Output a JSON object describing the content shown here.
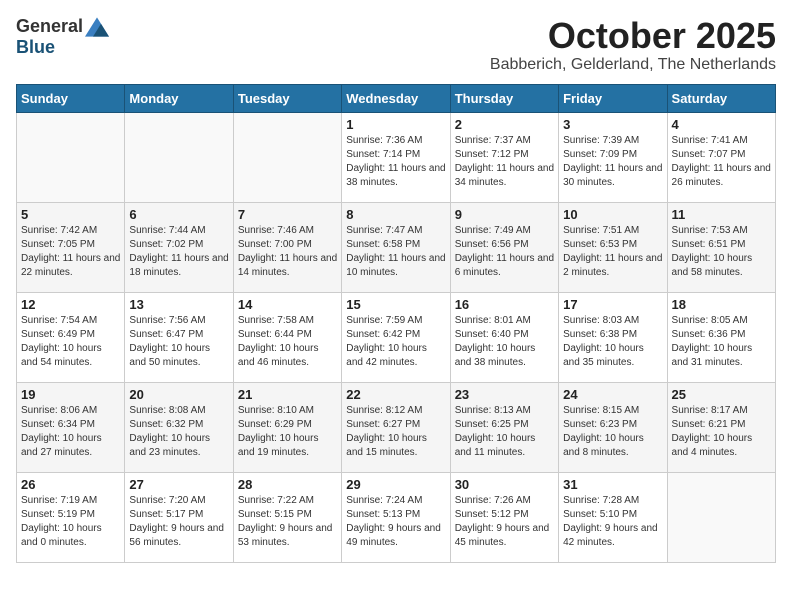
{
  "header": {
    "logo_general": "General",
    "logo_blue": "Blue",
    "month_title": "October 2025",
    "location": "Babberich, Gelderland, The Netherlands"
  },
  "weekdays": [
    "Sunday",
    "Monday",
    "Tuesday",
    "Wednesday",
    "Thursday",
    "Friday",
    "Saturday"
  ],
  "weeks": [
    [
      {
        "day": "",
        "sunrise": "",
        "sunset": "",
        "daylight": ""
      },
      {
        "day": "",
        "sunrise": "",
        "sunset": "",
        "daylight": ""
      },
      {
        "day": "",
        "sunrise": "",
        "sunset": "",
        "daylight": ""
      },
      {
        "day": "1",
        "sunrise": "Sunrise: 7:36 AM",
        "sunset": "Sunset: 7:14 PM",
        "daylight": "Daylight: 11 hours and 38 minutes."
      },
      {
        "day": "2",
        "sunrise": "Sunrise: 7:37 AM",
        "sunset": "Sunset: 7:12 PM",
        "daylight": "Daylight: 11 hours and 34 minutes."
      },
      {
        "day": "3",
        "sunrise": "Sunrise: 7:39 AM",
        "sunset": "Sunset: 7:09 PM",
        "daylight": "Daylight: 11 hours and 30 minutes."
      },
      {
        "day": "4",
        "sunrise": "Sunrise: 7:41 AM",
        "sunset": "Sunset: 7:07 PM",
        "daylight": "Daylight: 11 hours and 26 minutes."
      }
    ],
    [
      {
        "day": "5",
        "sunrise": "Sunrise: 7:42 AM",
        "sunset": "Sunset: 7:05 PM",
        "daylight": "Daylight: 11 hours and 22 minutes."
      },
      {
        "day": "6",
        "sunrise": "Sunrise: 7:44 AM",
        "sunset": "Sunset: 7:02 PM",
        "daylight": "Daylight: 11 hours and 18 minutes."
      },
      {
        "day": "7",
        "sunrise": "Sunrise: 7:46 AM",
        "sunset": "Sunset: 7:00 PM",
        "daylight": "Daylight: 11 hours and 14 minutes."
      },
      {
        "day": "8",
        "sunrise": "Sunrise: 7:47 AM",
        "sunset": "Sunset: 6:58 PM",
        "daylight": "Daylight: 11 hours and 10 minutes."
      },
      {
        "day": "9",
        "sunrise": "Sunrise: 7:49 AM",
        "sunset": "Sunset: 6:56 PM",
        "daylight": "Daylight: 11 hours and 6 minutes."
      },
      {
        "day": "10",
        "sunrise": "Sunrise: 7:51 AM",
        "sunset": "Sunset: 6:53 PM",
        "daylight": "Daylight: 11 hours and 2 minutes."
      },
      {
        "day": "11",
        "sunrise": "Sunrise: 7:53 AM",
        "sunset": "Sunset: 6:51 PM",
        "daylight": "Daylight: 10 hours and 58 minutes."
      }
    ],
    [
      {
        "day": "12",
        "sunrise": "Sunrise: 7:54 AM",
        "sunset": "Sunset: 6:49 PM",
        "daylight": "Daylight: 10 hours and 54 minutes."
      },
      {
        "day": "13",
        "sunrise": "Sunrise: 7:56 AM",
        "sunset": "Sunset: 6:47 PM",
        "daylight": "Daylight: 10 hours and 50 minutes."
      },
      {
        "day": "14",
        "sunrise": "Sunrise: 7:58 AM",
        "sunset": "Sunset: 6:44 PM",
        "daylight": "Daylight: 10 hours and 46 minutes."
      },
      {
        "day": "15",
        "sunrise": "Sunrise: 7:59 AM",
        "sunset": "Sunset: 6:42 PM",
        "daylight": "Daylight: 10 hours and 42 minutes."
      },
      {
        "day": "16",
        "sunrise": "Sunrise: 8:01 AM",
        "sunset": "Sunset: 6:40 PM",
        "daylight": "Daylight: 10 hours and 38 minutes."
      },
      {
        "day": "17",
        "sunrise": "Sunrise: 8:03 AM",
        "sunset": "Sunset: 6:38 PM",
        "daylight": "Daylight: 10 hours and 35 minutes."
      },
      {
        "day": "18",
        "sunrise": "Sunrise: 8:05 AM",
        "sunset": "Sunset: 6:36 PM",
        "daylight": "Daylight: 10 hours and 31 minutes."
      }
    ],
    [
      {
        "day": "19",
        "sunrise": "Sunrise: 8:06 AM",
        "sunset": "Sunset: 6:34 PM",
        "daylight": "Daylight: 10 hours and 27 minutes."
      },
      {
        "day": "20",
        "sunrise": "Sunrise: 8:08 AM",
        "sunset": "Sunset: 6:32 PM",
        "daylight": "Daylight: 10 hours and 23 minutes."
      },
      {
        "day": "21",
        "sunrise": "Sunrise: 8:10 AM",
        "sunset": "Sunset: 6:29 PM",
        "daylight": "Daylight: 10 hours and 19 minutes."
      },
      {
        "day": "22",
        "sunrise": "Sunrise: 8:12 AM",
        "sunset": "Sunset: 6:27 PM",
        "daylight": "Daylight: 10 hours and 15 minutes."
      },
      {
        "day": "23",
        "sunrise": "Sunrise: 8:13 AM",
        "sunset": "Sunset: 6:25 PM",
        "daylight": "Daylight: 10 hours and 11 minutes."
      },
      {
        "day": "24",
        "sunrise": "Sunrise: 8:15 AM",
        "sunset": "Sunset: 6:23 PM",
        "daylight": "Daylight: 10 hours and 8 minutes."
      },
      {
        "day": "25",
        "sunrise": "Sunrise: 8:17 AM",
        "sunset": "Sunset: 6:21 PM",
        "daylight": "Daylight: 10 hours and 4 minutes."
      }
    ],
    [
      {
        "day": "26",
        "sunrise": "Sunrise: 7:19 AM",
        "sunset": "Sunset: 5:19 PM",
        "daylight": "Daylight: 10 hours and 0 minutes."
      },
      {
        "day": "27",
        "sunrise": "Sunrise: 7:20 AM",
        "sunset": "Sunset: 5:17 PM",
        "daylight": "Daylight: 9 hours and 56 minutes."
      },
      {
        "day": "28",
        "sunrise": "Sunrise: 7:22 AM",
        "sunset": "Sunset: 5:15 PM",
        "daylight": "Daylight: 9 hours and 53 minutes."
      },
      {
        "day": "29",
        "sunrise": "Sunrise: 7:24 AM",
        "sunset": "Sunset: 5:13 PM",
        "daylight": "Daylight: 9 hours and 49 minutes."
      },
      {
        "day": "30",
        "sunrise": "Sunrise: 7:26 AM",
        "sunset": "Sunset: 5:12 PM",
        "daylight": "Daylight: 9 hours and 45 minutes."
      },
      {
        "day": "31",
        "sunrise": "Sunrise: 7:28 AM",
        "sunset": "Sunset: 5:10 PM",
        "daylight": "Daylight: 9 hours and 42 minutes."
      },
      {
        "day": "",
        "sunrise": "",
        "sunset": "",
        "daylight": ""
      }
    ]
  ]
}
